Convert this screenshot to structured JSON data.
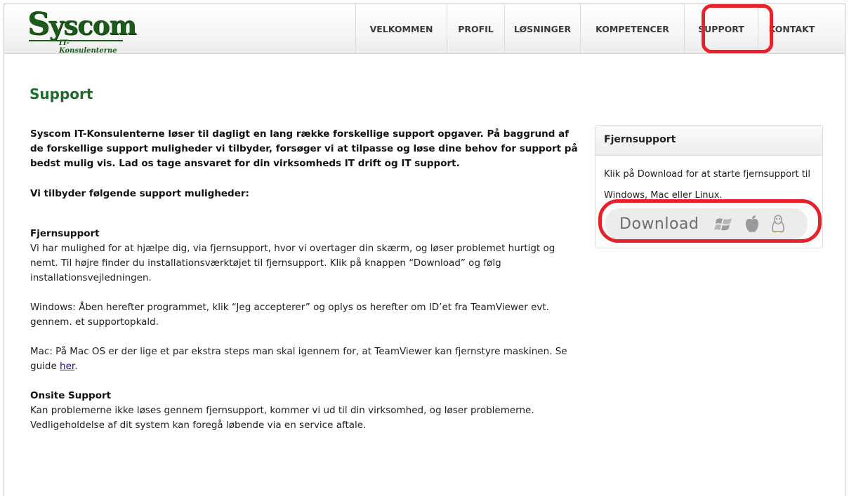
{
  "brand": {
    "logo_main_first": "S",
    "logo_main_rest": "yscom",
    "logo_sub": "IT-Konsulenterne"
  },
  "nav": [
    {
      "label": "VELKOMMEN"
    },
    {
      "label": "PROFIL"
    },
    {
      "label": "LØSNINGER"
    },
    {
      "label": "KOMPETENCER"
    },
    {
      "label": "SUPPORT"
    },
    {
      "label": "KONTAKT"
    }
  ],
  "colors": {
    "accent_green": "#1f6b2a",
    "highlight_red": "#e8202a",
    "link_blue": "#1a0dab"
  },
  "page": {
    "title": "Support",
    "lead": "Syscom IT-Konsulenterne løser til dagligt en lang række forskellige support opgaver. På baggrund af de forskellige support muligheder vi tilbyder, forsøger vi at tilpasse og løse dine behov for support på bedst mulig vis. Lad os tage ansvaret for din virksomheds IT drift og IT support.",
    "offer_heading": "Vi tilbyder følgende support muligheder:",
    "remote": {
      "heading": "Fjernsupport",
      "text": "Vi har mulighed for at hjælpe dig, via fjernsupport, hvor vi overtager din skærm, og løser problemet hurtigt og nemt. Til højre finder du installationsværktøjet til fjernsupport. Klik på knappen “Download” og følg installationsvejledningen.",
      "windows": "Windows: Åben herefter programmet, klik “Jeg accepterer” og oplys os herefter om ID’et fra TeamViewer evt. gennem. et supportopkald.",
      "mac_prefix": "Mac: På Mac OS er der lige et par ekstra steps man skal igennem for, at TeamViewer kan fjernstyre maskinen. Se guide ",
      "mac_link": "her",
      "mac_suffix": "."
    },
    "onsite": {
      "heading": "Onsite Support",
      "text": "Kan problemerne ikke løses gennem fjernsupport, kommer vi ud til din virksomhed, og løser problemerne. Vedligeholdelse af dit system kan foregå løbende via en service aftale."
    }
  },
  "sidebar": {
    "title": "Fjernsupport",
    "text": "Klik på Download for at starte fjernsupport til Windows, Mac eller Linux.",
    "button_label": "Download",
    "icons": [
      "windows-icon",
      "apple-icon",
      "linux-icon"
    ]
  }
}
